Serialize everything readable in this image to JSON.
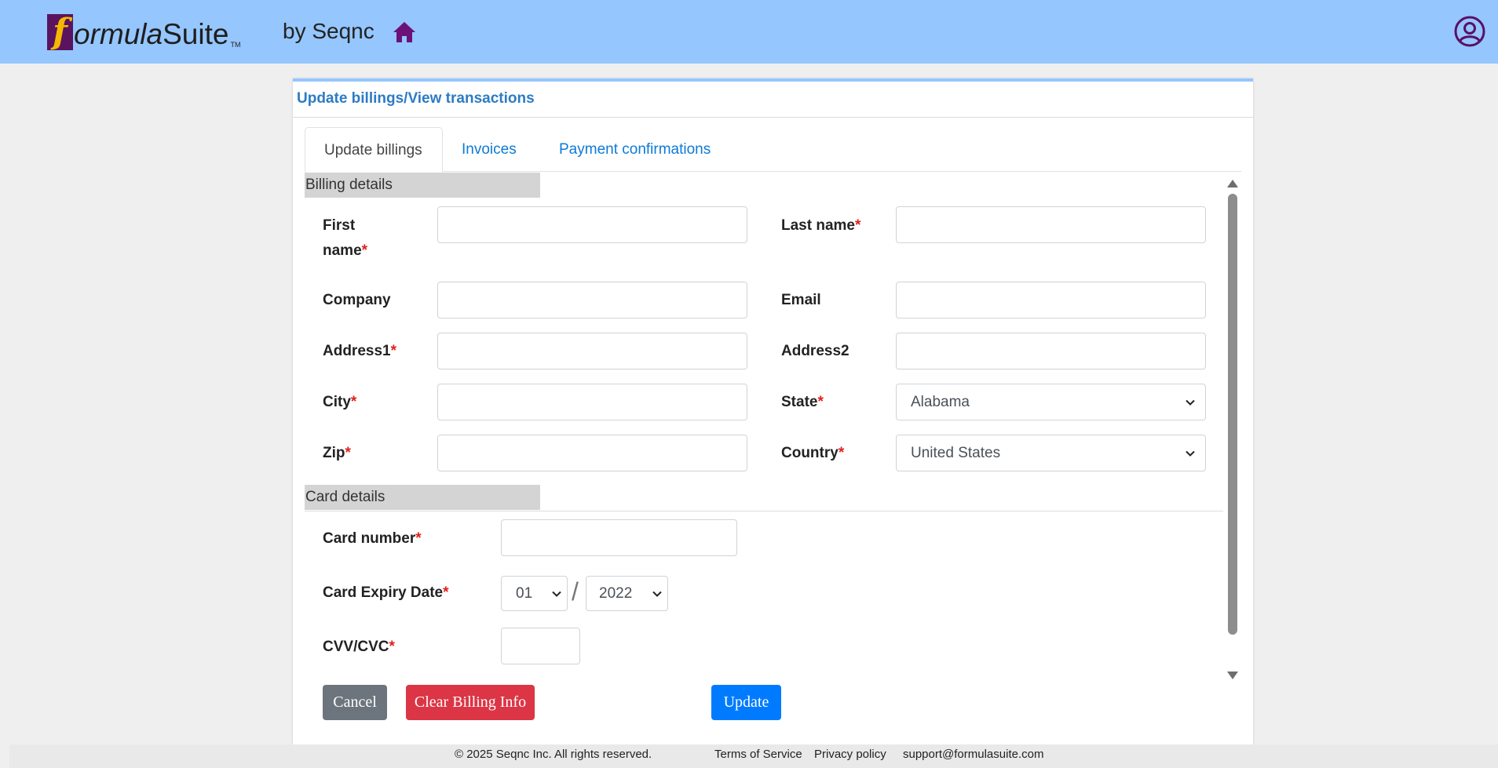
{
  "header": {
    "logo_f": "f",
    "logo_italic": "ormula",
    "logo_plain": "Suite",
    "logo_tm": "TM",
    "byline": "by Seqnc",
    "home_icon": "home-icon",
    "user_icon": "user-circle-icon"
  },
  "panel": {
    "title": "Update billings/View transactions",
    "tabs": [
      {
        "label": "Update billings",
        "active": true
      },
      {
        "label": "Invoices",
        "active": false
      },
      {
        "label": "Payment confirmations",
        "active": false
      }
    ]
  },
  "billing": {
    "section_title": "Billing details",
    "first_name": {
      "label_line1": "First",
      "label_line2": "name",
      "value": ""
    },
    "last_name": {
      "label": "Last name",
      "value": ""
    },
    "company": {
      "label": "Company",
      "value": ""
    },
    "email": {
      "label": "Email",
      "value": ""
    },
    "address1": {
      "label": "Address1",
      "value": ""
    },
    "address2": {
      "label": "Address2",
      "value": ""
    },
    "city": {
      "label": "City",
      "value": ""
    },
    "state": {
      "label": "State",
      "value": "Alabama"
    },
    "zip": {
      "label": "Zip",
      "value": ""
    },
    "country": {
      "label": "Country",
      "value": "United States"
    },
    "required_mark": "*"
  },
  "card": {
    "section_title": "Card details",
    "number": {
      "label": "Card number",
      "value": ""
    },
    "expiry": {
      "label": "Card Expiry Date",
      "month": "01",
      "separator": "/",
      "year": "2022"
    },
    "cvv": {
      "label": "CVV/CVC",
      "value": ""
    }
  },
  "buttons": {
    "cancel": "Cancel",
    "clear": "Clear Billing Info",
    "update": "Update"
  },
  "footer": {
    "copyright": "© 2025 Seqnc Inc. All rights reserved.",
    "terms": "Terms of Service",
    "privacy": "Privacy policy",
    "support": "support@formulasuite.com"
  },
  "colors": {
    "header_bg": "#95c6fd",
    "brand_purple": "#5a135f",
    "link_blue": "#0d7ad8",
    "required_red": "#e0201c",
    "cancel_gray": "#6c757d",
    "clear_red": "#dc3545",
    "update_blue": "#007bff"
  }
}
